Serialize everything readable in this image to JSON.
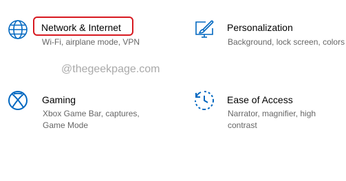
{
  "colors": {
    "accent": "#0067c0",
    "highlight": "#d71920",
    "title": "#000000",
    "description": "#666666",
    "watermark": "#a9a9a9"
  },
  "watermark": "@thegeekpage.com",
  "categories": [
    {
      "id": "network",
      "icon": "globe-icon",
      "title": "Network & Internet",
      "description": "Wi-Fi, airplane mode, VPN"
    },
    {
      "id": "personalization",
      "icon": "paint-brush-icon",
      "title": "Personalization",
      "description": "Background, lock screen, colors"
    },
    {
      "id": "gaming",
      "icon": "xbox-icon",
      "title": "Gaming",
      "description": "Xbox Game Bar, captures, Game Mode"
    },
    {
      "id": "ease-of-access",
      "icon": "ease-of-access-icon",
      "title": "Ease of Access",
      "description": "Narrator, magnifier, high contrast"
    }
  ]
}
